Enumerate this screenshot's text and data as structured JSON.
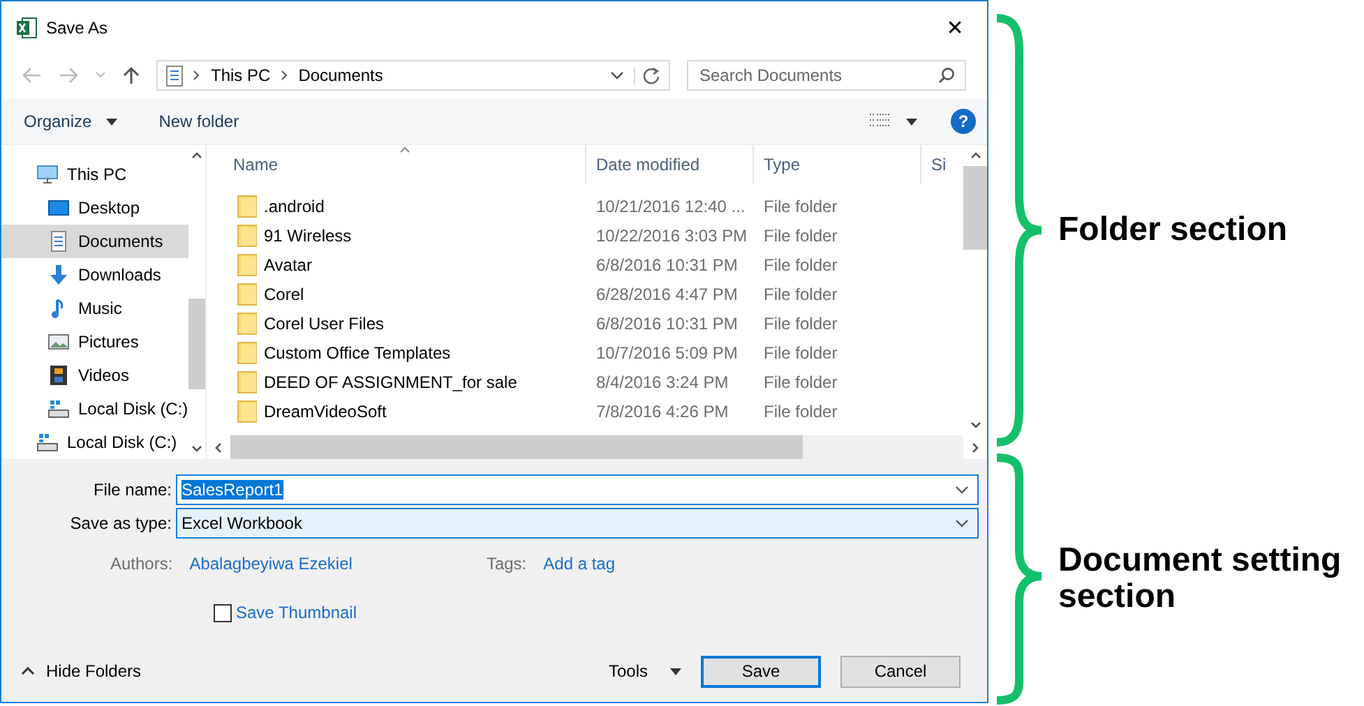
{
  "window": {
    "title": "Save As",
    "close": "✕"
  },
  "address": {
    "crumbs": [
      "This PC",
      "Documents"
    ],
    "search_placeholder": "Search Documents"
  },
  "toolbar": {
    "organize": "Organize",
    "new_folder": "New folder",
    "help": "?"
  },
  "nav": [
    {
      "label": "This PC",
      "kind": "pc",
      "selected": false,
      "children": [
        {
          "label": "Desktop",
          "kind": "desktop",
          "selected": false
        },
        {
          "label": "Documents",
          "kind": "documents",
          "selected": true
        },
        {
          "label": "Downloads",
          "kind": "downloads",
          "selected": false
        },
        {
          "label": "Music",
          "kind": "music",
          "selected": false
        },
        {
          "label": "Pictures",
          "kind": "pictures",
          "selected": false
        },
        {
          "label": "Videos",
          "kind": "videos",
          "selected": false
        },
        {
          "label": "Local Disk (C:)",
          "kind": "drive",
          "selected": false
        }
      ]
    },
    {
      "label": "Local Disk (C:)",
      "kind": "drive",
      "selected": false
    }
  ],
  "table": {
    "columns": [
      {
        "label": "Name",
        "sorted": true
      },
      {
        "label": "Date modified",
        "sorted": false
      },
      {
        "label": "Type",
        "sorted": false
      },
      {
        "label": "Si",
        "sorted": false
      }
    ],
    "rows": [
      {
        "name": ".android",
        "date": "10/21/2016 12:40 ...",
        "type": "File folder"
      },
      {
        "name": "91 Wireless",
        "date": "10/22/2016 3:03 PM",
        "type": "File folder"
      },
      {
        "name": "Avatar",
        "date": "6/8/2016 10:31 PM",
        "type": "File folder"
      },
      {
        "name": "Corel",
        "date": "6/28/2016 4:47 PM",
        "type": "File folder"
      },
      {
        "name": "Corel User Files",
        "date": "6/8/2016 10:31 PM",
        "type": "File folder"
      },
      {
        "name": "Custom Office Templates",
        "date": "10/7/2016 5:09 PM",
        "type": "File folder"
      },
      {
        "name": "DEED OF ASSIGNMENT_for sale",
        "date": "8/4/2016 3:24 PM",
        "type": "File folder"
      },
      {
        "name": "DreamVideoSoft",
        "date": "7/8/2016 4:26 PM",
        "type": "File folder"
      }
    ]
  },
  "form": {
    "file_name_label": "File name:",
    "file_name": "SalesReport1",
    "file_name_selected": true,
    "type_label": "Save as type:",
    "type": "Excel Workbook",
    "authors_label": "Authors:",
    "authors": "Abalagbeyiwa Ezekiel",
    "tags_label": "Tags:",
    "tags": "Add a tag",
    "thumbnail": {
      "label": "Save Thumbnail",
      "checked": false
    }
  },
  "footer": {
    "hide_folders": "Hide Folders",
    "tools": "Tools",
    "save": "Save",
    "cancel": "Cancel"
  },
  "annotations": [
    {
      "label": "Folder section"
    },
    {
      "label": "Document setting section"
    }
  ]
}
